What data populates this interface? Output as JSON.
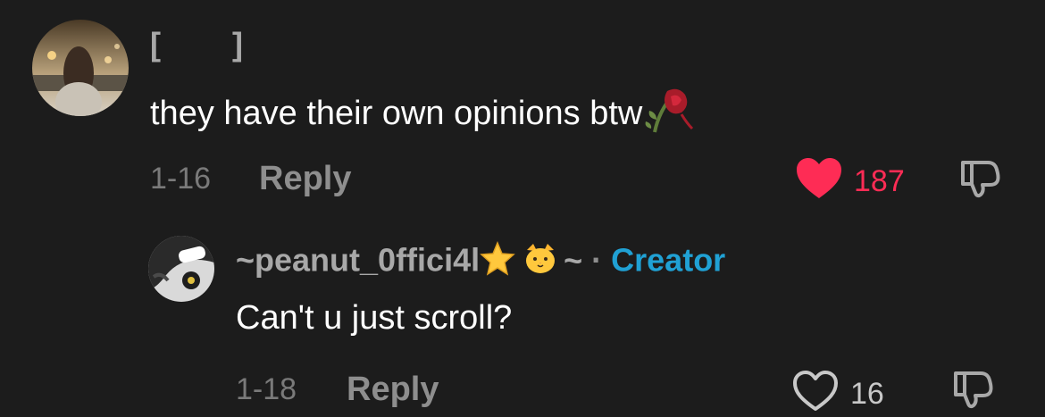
{
  "colors": {
    "background": "#1c1c1c",
    "liked": "#fe2c55",
    "creator": "#20a1d4"
  },
  "comment": {
    "username": "[        ]",
    "text": "they have their own opinions btw",
    "text_emoji_icon": "wilted-rose-icon",
    "date": "1-16",
    "reply_label": "Reply",
    "likes": "187",
    "liked": true
  },
  "reply": {
    "username": "~peanut_0ffici4l",
    "username_emojis": [
      "star-icon",
      "cat-face-icon"
    ],
    "username_suffix": "~",
    "separator": "·",
    "badge": "Creator",
    "text": "Can't u just scroll?",
    "date": "1-18",
    "reply_label": "Reply",
    "likes": "16",
    "liked": false
  }
}
